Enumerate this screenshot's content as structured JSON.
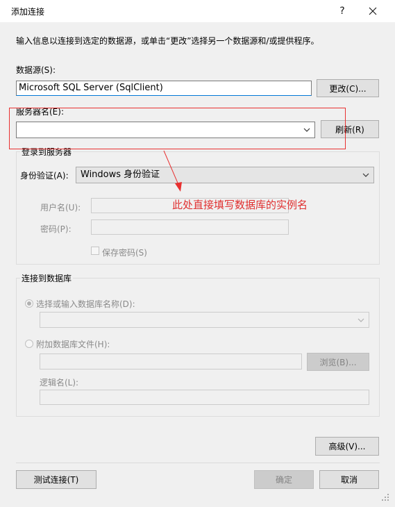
{
  "window": {
    "title": "添加连接",
    "help_label": "?"
  },
  "intro": "输入信息以连接到选定的数据源，或单击“更改”选择另一个数据源和/或提供程序。",
  "datasource": {
    "label": "数据源(S):",
    "value": "Microsoft SQL Server (SqlClient)",
    "change_button": "更改(C)..."
  },
  "server": {
    "label": "服务器名(E):",
    "value": "",
    "refresh_button": "刷新(R)"
  },
  "login_group": {
    "title": "登录到服务器",
    "auth_label": "身份验证(A):",
    "auth_value": "Windows 身份验证",
    "username_label": "用户名(U):",
    "password_label": "密码(P):",
    "save_password_label": "保存密码(S)"
  },
  "db_group": {
    "title": "连接到数据库",
    "select_db_label": "选择或输入数据库名称(D):",
    "attach_file_label": "附加数据库文件(H):",
    "browse_button": "浏览(B)...",
    "logical_name_label": "逻辑名(L):"
  },
  "buttons": {
    "advanced": "高级(V)...",
    "test": "测试连接(T)",
    "ok": "确定",
    "cancel": "取消"
  },
  "annotation": {
    "text": "此处直接填写数据库的实例名",
    "color": "#e03030"
  },
  "colors": {
    "accent": "#0078d7",
    "annotation": "#e83030"
  }
}
